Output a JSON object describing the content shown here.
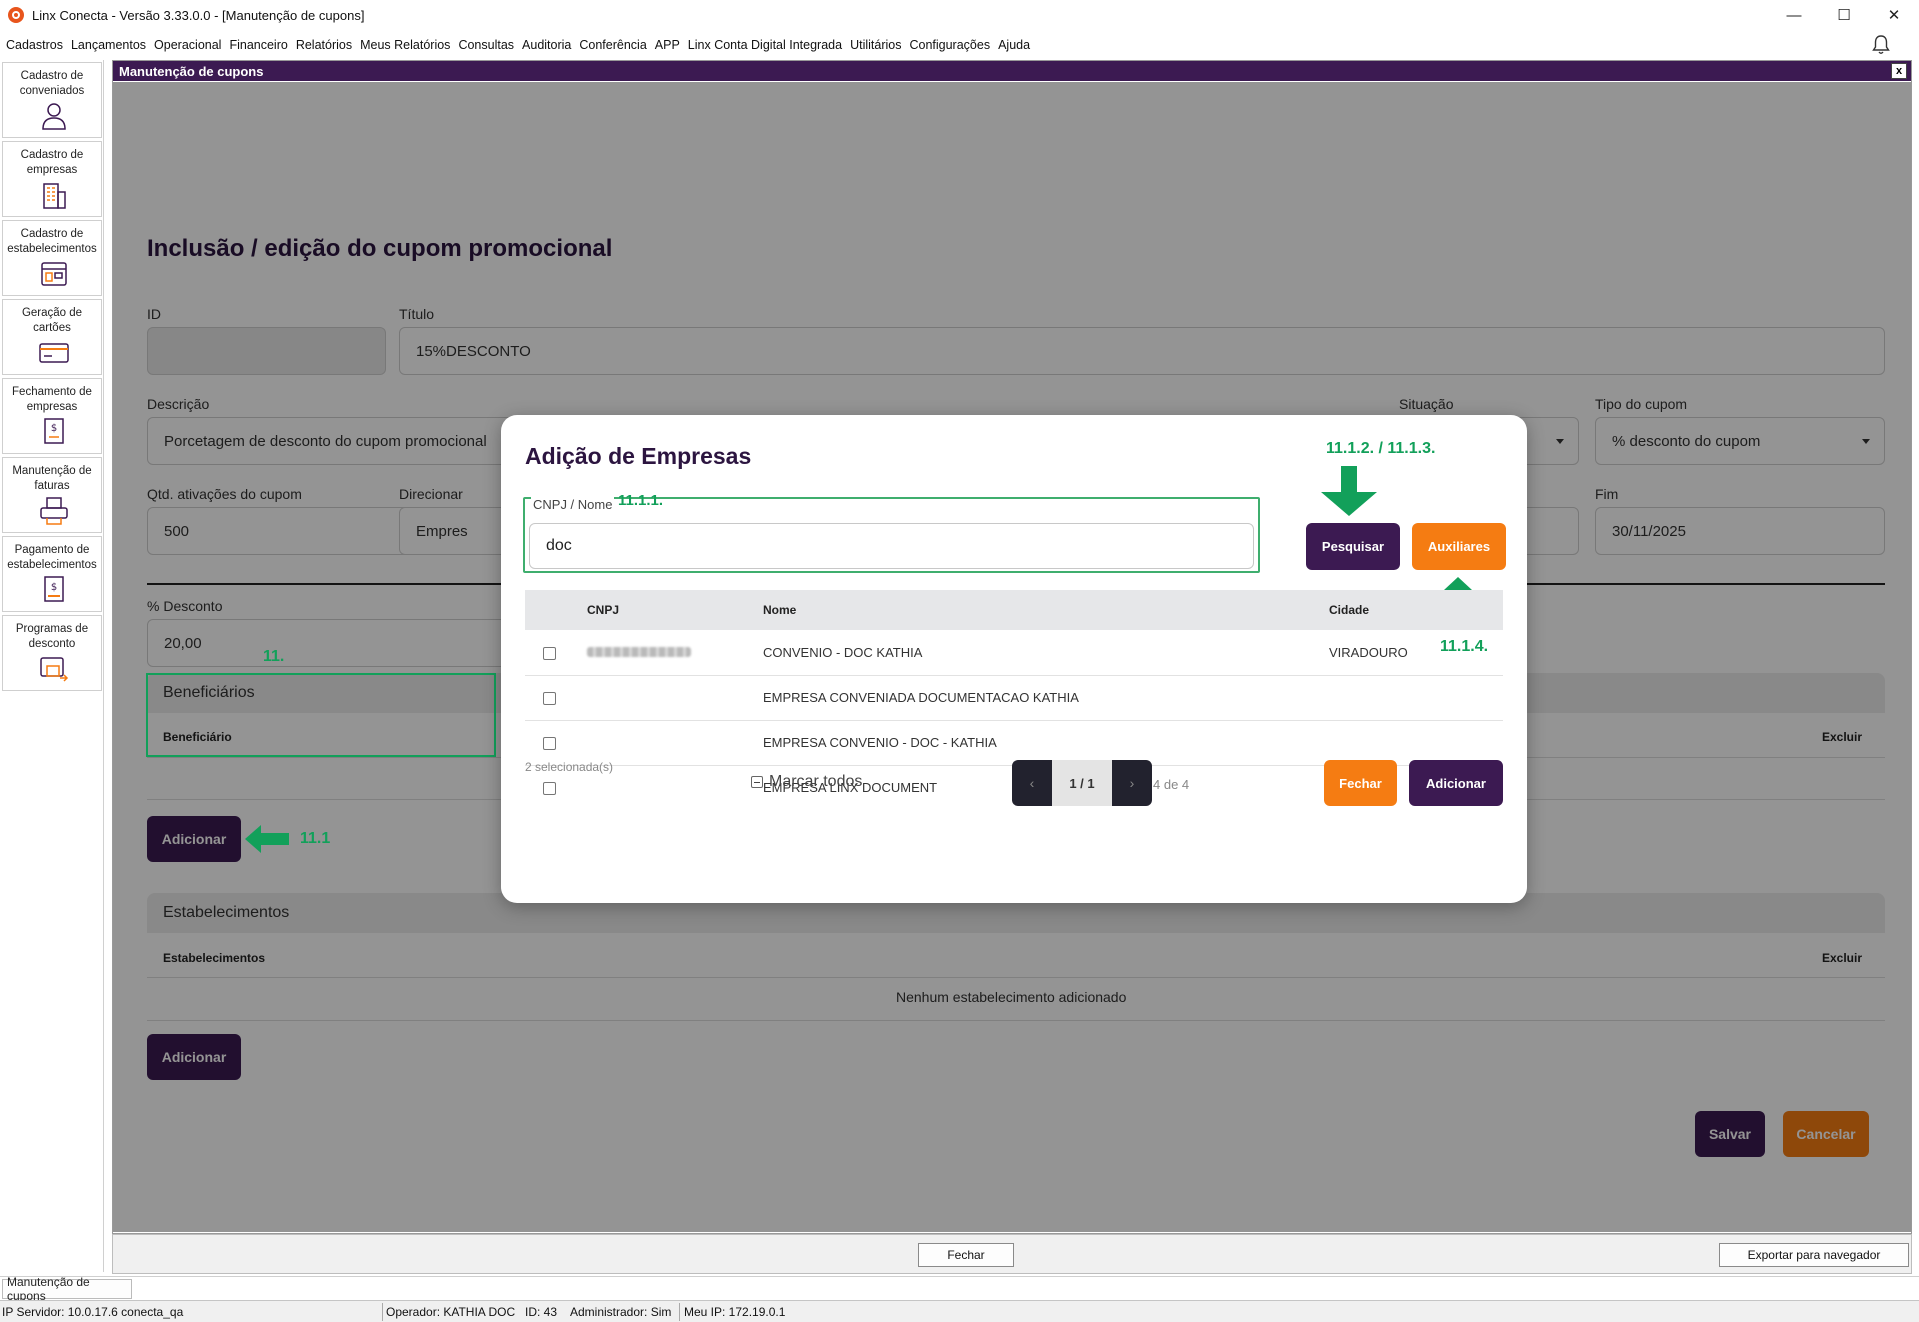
{
  "window": {
    "title": "Linx Conecta - Versão 3.33.0.0 - [Manutenção de cupons]",
    "minimize": "—",
    "maximize": "☐",
    "close": "✕"
  },
  "menu": [
    "Cadastros",
    "Lançamentos",
    "Operacional",
    "Financeiro",
    "Relatórios",
    "Meus Relatórios",
    "Consultas",
    "Auditoria",
    "Conferência",
    "APP",
    "Linx Conta Digital Integrada",
    "Utilitários",
    "Configurações",
    "Ajuda"
  ],
  "sidebar": [
    {
      "label": "Cadastro de conveniados",
      "icon": "user-icon"
    },
    {
      "label": "Cadastro de empresas",
      "icon": "building-icon"
    },
    {
      "label": "Cadastro de estabelecimentos",
      "icon": "store-icon"
    },
    {
      "label": "Geração de cartões",
      "icon": "card-icon"
    },
    {
      "label": "Fechamento de empresas",
      "icon": "invoice-icon"
    },
    {
      "label": "Manutenção de faturas",
      "icon": "printer-icon"
    },
    {
      "label": "Pagamento de estabelecimentos",
      "icon": "payment-icon"
    },
    {
      "label": "Programas de desconto",
      "icon": "discount-icon"
    }
  ],
  "mdi": {
    "title": "Manutenção de cupons",
    "close": "x"
  },
  "form": {
    "page_title": "Inclusão / edição do cupom promocional",
    "id_label": "ID",
    "id_value": "",
    "titulo_label": "Título",
    "titulo_value": "15%DESCONTO",
    "descricao_label": "Descrição",
    "descricao_value": "Porcetagem de desconto do cupom promocional",
    "situacao_label": "Situação",
    "situacao_value": "",
    "tipo_label": "Tipo do cupom",
    "tipo_value": "% desconto do cupom",
    "qtd_label": "Qtd. ativações do cupom",
    "qtd_value": "500",
    "direcionar_label": "Direcionar",
    "direcionar_value": "Empres",
    "fim_label": "Fim",
    "fim_value": "30/11/2025",
    "desconto_label": "% Desconto",
    "desconto_value": "20,00"
  },
  "beneficiarios": {
    "heading": "Beneficiários",
    "col_beneficiario": "Beneficiário",
    "col_excluir": "Excluir",
    "add_button": "Adicionar"
  },
  "estabelecimentos": {
    "heading": "Estabelecimentos",
    "col_estabelecimentos": "Estabelecimentos",
    "col_excluir": "Excluir",
    "empty": "Nenhum estabelecimento adicionado",
    "add_button": "Adicionar"
  },
  "actions": {
    "save": "Salvar",
    "cancel": "Cancelar"
  },
  "modal": {
    "title": "Adição de Empresas",
    "search_label": "CNPJ / Nome",
    "search_value": "doc",
    "search_button": "Pesquisar",
    "aux_button": "Auxiliares",
    "columns": {
      "cnpj": "CNPJ",
      "nome": "Nome",
      "cidade": "Cidade"
    },
    "rows": [
      {
        "cnpj_blurred": true,
        "nome": "CONVENIO - DOC KATHIA",
        "cidade": "VIRADOURO"
      },
      {
        "cnpj_blurred": false,
        "nome": "EMPRESA CONVENIADA DOCUMENTACAO KATHIA",
        "cidade": ""
      },
      {
        "cnpj_blurred": false,
        "nome": "EMPRESA CONVENIO - DOC - KATHIA",
        "cidade": ""
      },
      {
        "cnpj_blurred": false,
        "nome": "EMPRESA LINX DOCUMENT",
        "cidade": ""
      }
    ],
    "selected_count": "2 selecionada(s)",
    "mark_all": "Marcar todos",
    "pager_prev": "‹",
    "pager_page": "1 / 1",
    "pager_next": "›",
    "count": "4 de 4",
    "close_button": "Fechar",
    "add_button": "Adicionar"
  },
  "annotations": {
    "search_field": "11.1.1.",
    "search_buttons": "11.1.2. / 11.1.3.",
    "aux": "11.1.4.",
    "beneficiarios": "11.",
    "add": "11.1",
    "color": "#12a05a"
  },
  "bottom": {
    "fechar": "Fechar",
    "exportar": "Exportar para navegador"
  },
  "taskbar": {
    "task": "Manutenção de cupons"
  },
  "status": {
    "server": "IP Servidor: 10.0.17.6 conecta_qa",
    "operador": "Operador: KATHIA DOC",
    "id": "ID: 43",
    "admin": "Administrador: Sim",
    "ip": "Meu IP: 172.19.0.1"
  },
  "colors": {
    "brand_purple": "#3c1a52",
    "accent_orange": "#f57c12",
    "annotation_green": "#12a05a"
  }
}
